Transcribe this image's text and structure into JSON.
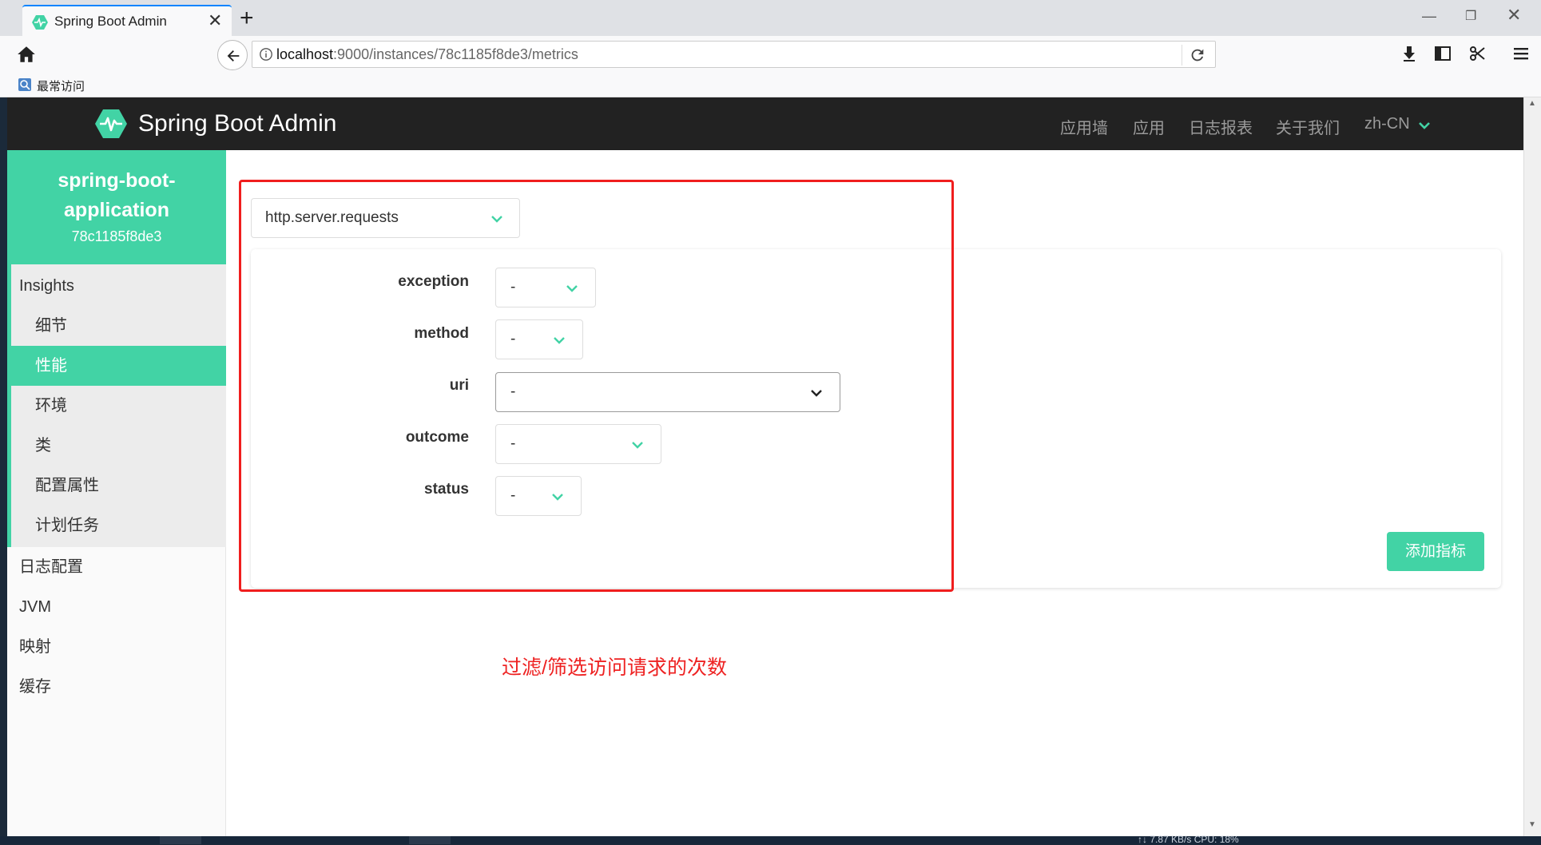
{
  "browser": {
    "tab_title": "Spring Boot Admin",
    "tab_close": "✕",
    "new_tab": "+",
    "url_host": "localhost",
    "url_rest": ":9000/instances/78c1185f8de3/metrics",
    "bookmark_label": "最常访问",
    "window_min": "—",
    "window_max": "❐",
    "window_close": "✕"
  },
  "app": {
    "brand": "Spring Boot Admin",
    "nav": [
      "应用墙",
      "应用",
      "日志报表",
      "关于我们"
    ],
    "lang": "zh-CN",
    "accent_color": "#42d3a5"
  },
  "instance": {
    "name": "spring-boot-application",
    "id": "78c1185f8de3"
  },
  "sidebar": {
    "group_title": "Insights",
    "insights_items": [
      "细节",
      "性能",
      "环境",
      "类",
      "配置属性",
      "计划任务"
    ],
    "active_item": "性能",
    "other_items": [
      "日志配置",
      "JVM",
      "映射",
      "缓存"
    ]
  },
  "metrics": {
    "selected_metric": "http.server.requests",
    "tags": [
      {
        "label": "exception",
        "value": "-"
      },
      {
        "label": "method",
        "value": "-"
      },
      {
        "label": "uri",
        "value": "-"
      },
      {
        "label": "outcome",
        "value": "-"
      },
      {
        "label": "status",
        "value": "-"
      }
    ],
    "add_button": "添加指标"
  },
  "annotation": "过滤/筛选访问请求的次数",
  "taskbar": {
    "stats": "↑↓ 7.87 KB/s   CPU: 18%"
  }
}
